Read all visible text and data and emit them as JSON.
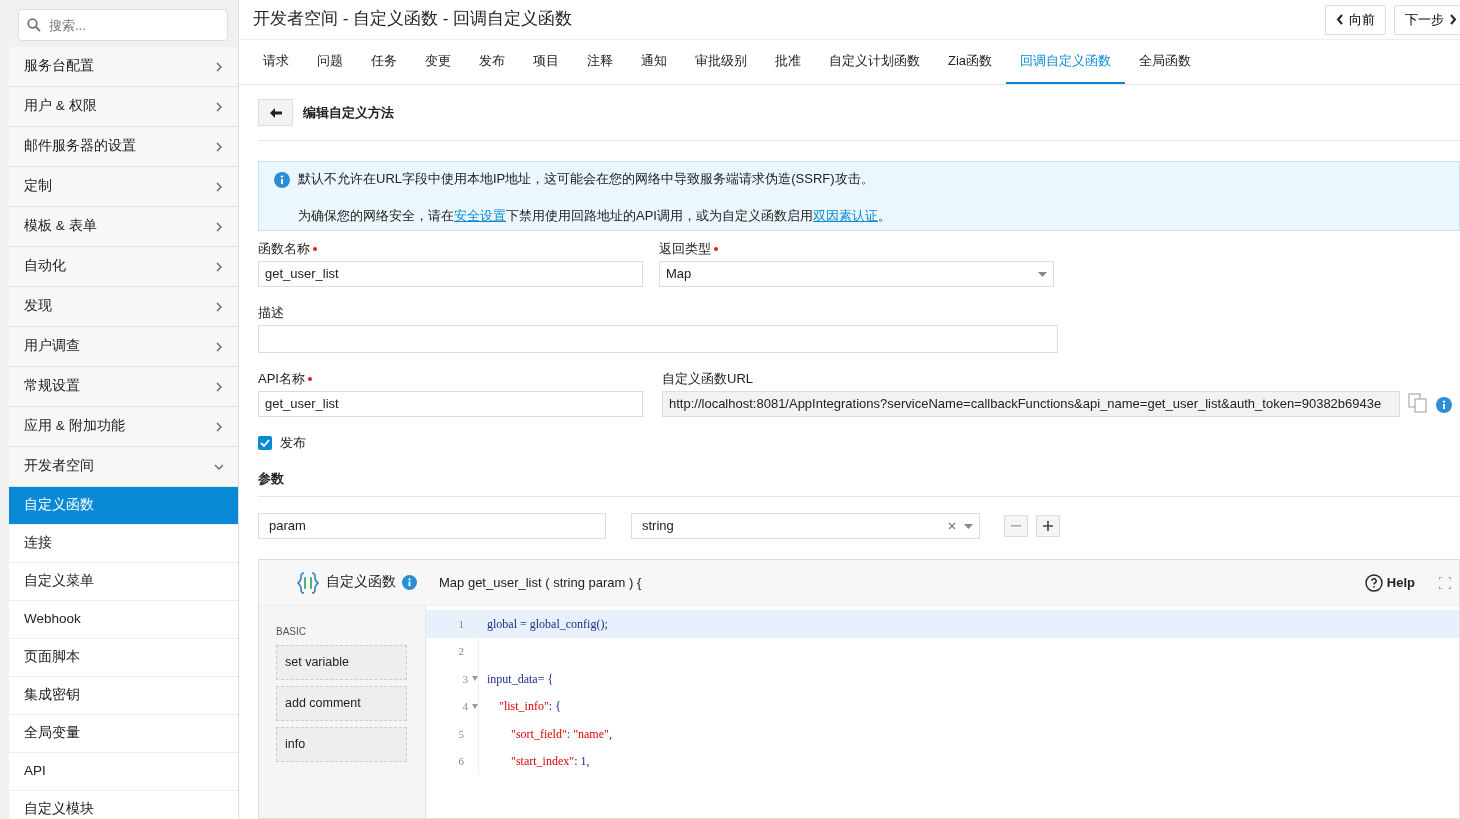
{
  "sidebar": {
    "search": {
      "placeholder": "搜索..."
    },
    "items": [
      {
        "label": "服务台配置",
        "expanded": false
      },
      {
        "label": "用户 & 权限",
        "expanded": false
      },
      {
        "label": "邮件服务器的设置",
        "expanded": false
      },
      {
        "label": "定制",
        "expanded": false
      },
      {
        "label": "模板 & 表单",
        "expanded": false
      },
      {
        "label": "自动化",
        "expanded": false
      },
      {
        "label": "发现",
        "expanded": false
      },
      {
        "label": "用户调查",
        "expanded": false
      },
      {
        "label": "常规设置",
        "expanded": false
      },
      {
        "label": "应用 & 附加功能",
        "expanded": false
      },
      {
        "label": "开发者空间",
        "expanded": true,
        "children": [
          {
            "label": "自定义函数",
            "selected": true
          },
          {
            "label": "连接",
            "selected": false
          },
          {
            "label": "自定义菜单",
            "selected": false
          },
          {
            "label": "Webhook",
            "selected": false
          },
          {
            "label": "页面脚本",
            "selected": false
          },
          {
            "label": "集成密钥",
            "selected": false
          },
          {
            "label": "全局变量",
            "selected": false
          },
          {
            "label": "API",
            "selected": false
          },
          {
            "label": "自定义模块",
            "selected": false
          }
        ]
      }
    ]
  },
  "header": {
    "title": "开发者空间 - 自定义函数 - 回调自定义函数",
    "buttons": [
      {
        "kind": "prev",
        "label": "向前"
      },
      {
        "kind": "next",
        "label": "下一步"
      }
    ]
  },
  "tabs": [
    {
      "label": "请求",
      "selected": false
    },
    {
      "label": "问题",
      "selected": false
    },
    {
      "label": "任务",
      "selected": false
    },
    {
      "label": "变更",
      "selected": false
    },
    {
      "label": "发布",
      "selected": false
    },
    {
      "label": "项目",
      "selected": false
    },
    {
      "label": "注释",
      "selected": false
    },
    {
      "label": "通知",
      "selected": false
    },
    {
      "label": "审批级别",
      "selected": false
    },
    {
      "label": "批准",
      "selected": false
    },
    {
      "label": "自定义计划函数",
      "selected": false
    },
    {
      "label": "Zia函数",
      "selected": false
    },
    {
      "label": "回调自定义函数",
      "selected": true
    },
    {
      "label": "全局函数",
      "selected": false
    }
  ],
  "section_title": "编辑自定义方法",
  "alert": {
    "message": "默认不允许在URL字段中使用本地IP地址，这可能会在您的网络中导致服务端请求伪造(SSRF)攻击。",
    "note": [
      {
        "kind": "text",
        "text": "为确保您的网络安全，请在"
      },
      {
        "kind": "link",
        "text": "安全设置"
      },
      {
        "kind": "text",
        "text": "下禁用使用回路地址的API调用，或为自定义函数启用"
      },
      {
        "kind": "link",
        "text": "双因素认证"
      },
      {
        "kind": "text",
        "text": "。"
      }
    ]
  },
  "form": {
    "function_name": {
      "label": "函数名称",
      "required": true,
      "value": "get_user_list"
    },
    "return_type": {
      "label": "返回类型",
      "required": true,
      "value": "Map"
    },
    "description": {
      "label": "描述"
    },
    "api_name": {
      "label": "API名称",
      "required": true,
      "value": "get_user_list"
    },
    "url": {
      "label": "自定义函数URL",
      "value": "http://localhost:8081/AppIntegrations?serviceName=callbackFunctions&api_name=get_user_list&auth_token=90382b6943e"
    },
    "publish": {
      "label": "发布",
      "checked": true
    }
  },
  "params": {
    "title": "参数",
    "rows": [
      {
        "name": "param",
        "type": "string"
      }
    ]
  },
  "editor": {
    "title": "自定义函数",
    "signature": "Map get_user_list ( string param ) {",
    "help": "Help",
    "palette": {
      "section": "BASIC",
      "items": [
        "set variable",
        "add comment",
        "info"
      ]
    },
    "lines": [
      {
        "number": "1",
        "highlighted": true,
        "foldable": false,
        "tokens": [
          {
            "kind": "plain",
            "text": "global = global_config();"
          }
        ]
      },
      {
        "number": "2",
        "highlighted": false,
        "foldable": false
      },
      {
        "number": "3",
        "highlighted": false,
        "foldable": true,
        "tokens": [
          {
            "kind": "plain",
            "text": "input_data= {"
          }
        ]
      },
      {
        "number": "4",
        "highlighted": false,
        "foldable": true,
        "tokens": [
          {
            "kind": "string",
            "text": "    \"list_info\""
          },
          {
            "kind": "plain",
            "text": ": {"
          }
        ]
      },
      {
        "number": "5",
        "highlighted": false,
        "foldable": false,
        "tokens": [
          {
            "kind": "string",
            "text": "        \"sort_field\""
          },
          {
            "kind": "plain",
            "text": ": "
          },
          {
            "kind": "string",
            "text": "\"name\""
          },
          {
            "kind": "plain",
            "text": ","
          }
        ]
      },
      {
        "number": "6",
        "highlighted": false,
        "foldable": false,
        "tokens": [
          {
            "kind": "string",
            "text": "        \"start_index\""
          },
          {
            "kind": "plain",
            "text": ": 1,"
          }
        ]
      }
    ]
  }
}
